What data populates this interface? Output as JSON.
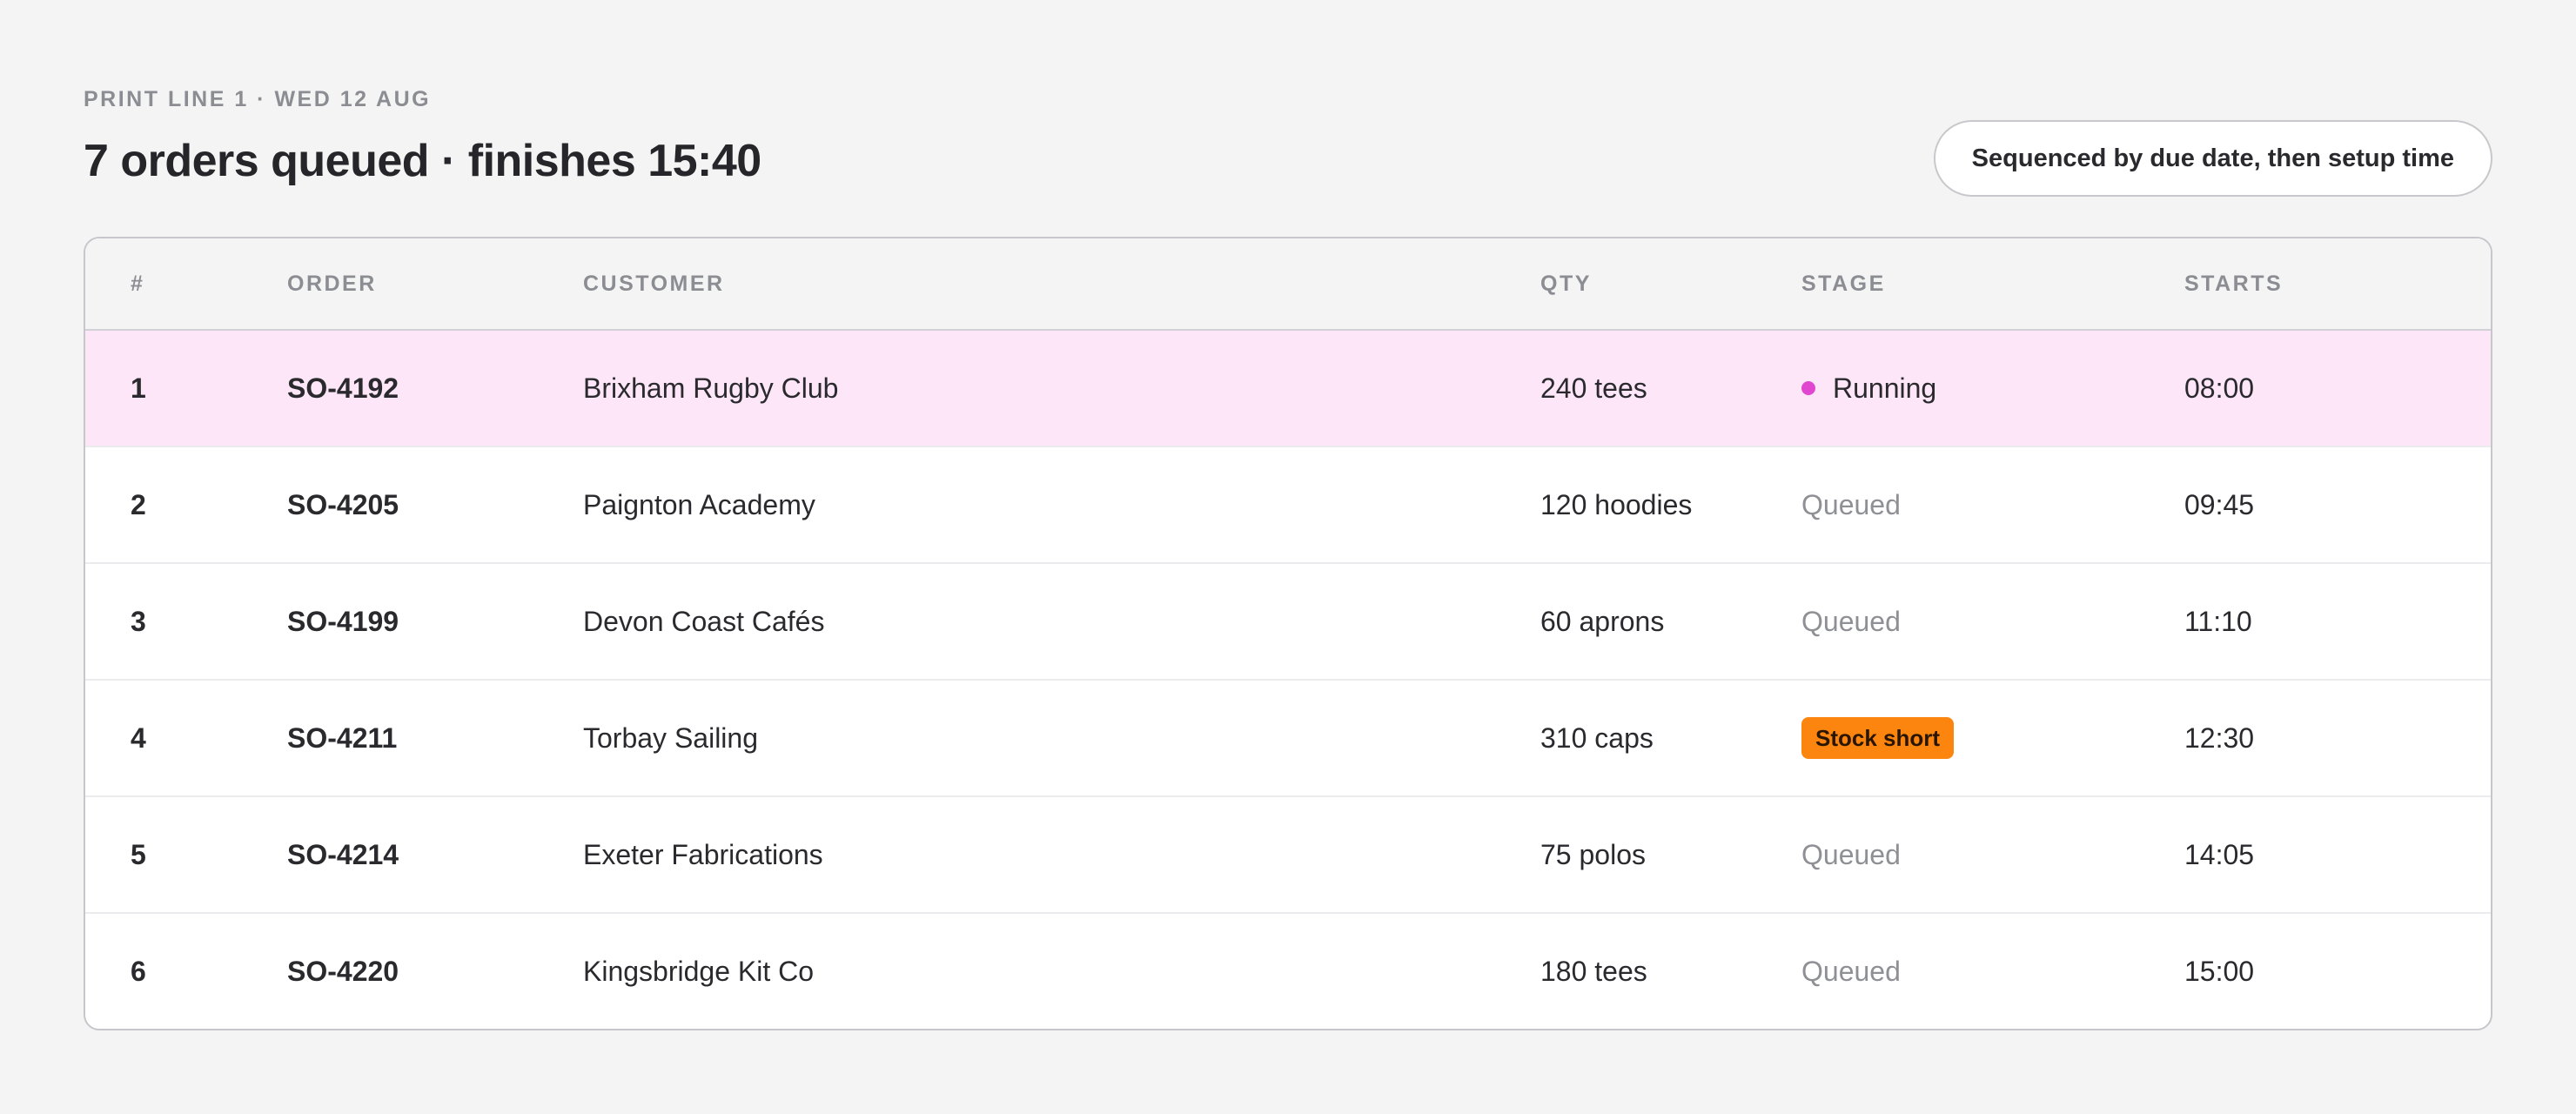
{
  "header": {
    "eyebrow": "PRINT LINE 1 · WED 12 AUG",
    "title": "7 orders queued · finishes 15:40",
    "sequence_label": "Sequenced by due date, then setup time"
  },
  "table": {
    "columns": [
      "#",
      "ORDER",
      "CUSTOMER",
      "QTY",
      "STAGE",
      "STARTS"
    ],
    "rows": [
      {
        "num": "1",
        "order": "SO-4192",
        "customer": "Brixham Rugby Club",
        "qty": "240 tees",
        "stage": "Running",
        "stage_type": "running",
        "starts": "08:00"
      },
      {
        "num": "2",
        "order": "SO-4205",
        "customer": "Paignton Academy",
        "qty": "120 hoodies",
        "stage": "Queued",
        "stage_type": "queued",
        "starts": "09:45"
      },
      {
        "num": "3",
        "order": "SO-4199",
        "customer": "Devon Coast Cafés",
        "qty": "60 aprons",
        "stage": "Queued",
        "stage_type": "queued",
        "starts": "11:10"
      },
      {
        "num": "4",
        "order": "SO-4211",
        "customer": "Torbay Sailing",
        "qty": "310 caps",
        "stage": "Stock short",
        "stage_type": "alert",
        "starts": "12:30"
      },
      {
        "num": "5",
        "order": "SO-4214",
        "customer": "Exeter Fabrications",
        "qty": "75 polos",
        "stage": "Queued",
        "stage_type": "queued",
        "starts": "14:05"
      },
      {
        "num": "6",
        "order": "SO-4220",
        "customer": "Kingsbridge Kit Co",
        "qty": "180 tees",
        "stage": "Queued",
        "stage_type": "queued",
        "starts": "15:00"
      }
    ]
  },
  "colors": {
    "running_row_bg": "#fce6f8",
    "running_dot": "#e046cf",
    "alert_badge": "#fb850f",
    "queued_text": "#8f9096"
  }
}
